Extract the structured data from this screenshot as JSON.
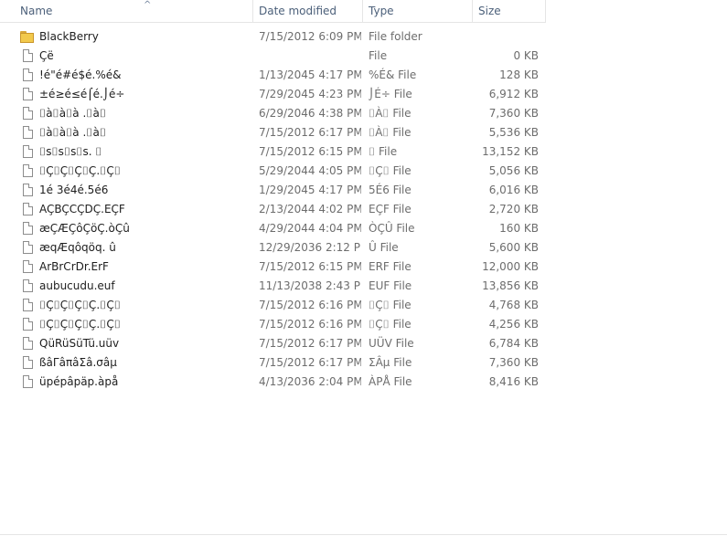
{
  "header": {
    "columns": [
      "Name",
      "Date modified",
      "Type",
      "Size"
    ]
  },
  "files": [
    {
      "name": "BlackBerry",
      "date": "7/15/2012 6:09 PM",
      "type": "File folder",
      "size": "",
      "icon": "folder-icon"
    },
    {
      "name": "Çë",
      "date": "",
      "type": "File",
      "size": "0 KB",
      "icon": "file-icon"
    },
    {
      "name": "!é\"é#é$é.%é&",
      "date": "1/13/2045 4:17 PM",
      "type": "%É& File",
      "size": "128 KB",
      "icon": "file-icon"
    },
    {
      "name": "±é≥é≤é⌠é.⌡é÷",
      "date": "7/29/2045 4:23 PM",
      "type": "⌡É÷ File",
      "size": "6,912 KB",
      "icon": "file-icon"
    },
    {
      "name": "⌷à⌷à⌷à .⌷à⌷",
      "date": "6/29/2046 4:38 PM",
      "type": "⌷À⌷ File",
      "size": "7,360 KB",
      "icon": "file-icon"
    },
    {
      "name": "⌷à⌷à⌷à .⌷à⌷",
      "date": "7/15/2012 6:17 PM",
      "type": "⌷À⌷ File",
      "size": "5,536 KB",
      "icon": "file-icon"
    },
    {
      "name": "⌷s⌷s⌷s⌷s. ⌷",
      "date": "7/15/2012 6:15 PM",
      "type": "⌷ File",
      "size": "13,152 KB",
      "icon": "file-icon"
    },
    {
      "name": "⌷Ç⌷Ç⌷Ç⌷Ç.⌷Ç⌷",
      "date": "5/29/2044 4:05 PM",
      "type": "⌷Ç⌷ File",
      "size": "5,056 KB",
      "icon": "file-icon"
    },
    {
      "name": "1é 3é4é.5é6",
      "date": "1/29/2045 4:17 PM",
      "type": "5É6 File",
      "size": "6,016 KB",
      "icon": "file-icon"
    },
    {
      "name": "AÇBÇCÇDÇ.EÇF",
      "date": "2/13/2044 4:02 PM",
      "type": "EÇF File",
      "size": "2,720 KB",
      "icon": "file-icon"
    },
    {
      "name": "æÇÆÇôÇöÇ.òÇû",
      "date": "4/29/2044 4:04 PM",
      "type": "ÒÇÛ File",
      "size": "160 KB",
      "icon": "file-icon"
    },
    {
      "name": "æqÆqôqöq. û",
      "date": "12/29/2036 2:12 PM",
      "type": "Û File",
      "size": "5,600 KB",
      "icon": "file-icon"
    },
    {
      "name": "ArBrCrDr.ErF",
      "date": "7/15/2012 6:15 PM",
      "type": "ERF File",
      "size": "12,000 KB",
      "icon": "file-icon"
    },
    {
      "name": "aubucudu.euf",
      "date": "11/13/2038 2:43 PM",
      "type": "EUF File",
      "size": "13,856 KB",
      "icon": "file-icon"
    },
    {
      "name": "⌷Ç⌷Ç⌷Ç⌷Ç.⌷Ç⌷",
      "date": "7/15/2012 6:16 PM",
      "type": "⌷Ç⌷ File",
      "size": "4,768 KB",
      "icon": "file-icon"
    },
    {
      "name": "⌷Ç⌷Ç⌷Ç⌷Ç.⌷Ç⌷",
      "date": "7/15/2012 6:16 PM",
      "type": "⌷Ç⌷ File",
      "size": "4,256 KB",
      "icon": "file-icon"
    },
    {
      "name": "QüRüSüTü.uüv",
      "date": "7/15/2012 6:17 PM",
      "type": "UÜV File",
      "size": "6,784 KB",
      "icon": "file-icon"
    },
    {
      "name": "ßâΓâπâΣâ.σâµ",
      "date": "7/15/2012 6:17 PM",
      "type": "ΣÂµ File",
      "size": "7,360 KB",
      "icon": "file-icon"
    },
    {
      "name": "üpépâpäp.àpå",
      "date": "4/13/2036 2:04 PM",
      "type": "ÀPÅ File",
      "size": "8,416 KB",
      "icon": "file-icon"
    }
  ],
  "colors": {
    "header_text": "#4c607a",
    "secondary_text": "#6d6d6d",
    "folder": "#f2c94c"
  }
}
